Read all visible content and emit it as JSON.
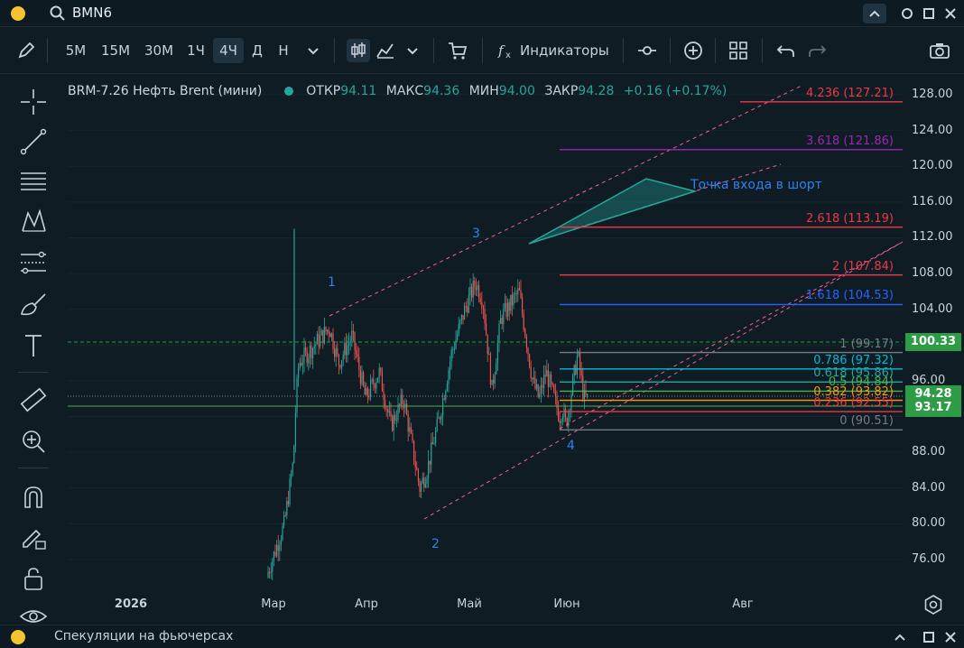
{
  "window": {
    "symbol": "BMN6"
  },
  "toolbar": {
    "timeframes": [
      "5М",
      "15М",
      "30М",
      "1Ч",
      "4Ч",
      "Д",
      "Н"
    ],
    "active_timeframe": "4Ч",
    "indicators_label": "Индикаторы"
  },
  "legend": {
    "title": "BRM-7.26 Нефть Brent (мини)",
    "open_label": "ОТКР",
    "open": "94.11",
    "high_label": "МАКС",
    "high": "94.36",
    "low_label": "МИН",
    "low": "94.00",
    "close_label": "ЗАКР",
    "close": "94.28",
    "change": "+0.16 (+0.17%)"
  },
  "y_axis": {
    "ticks": [
      "128.00",
      "124.00",
      "120.00",
      "116.00",
      "112.00",
      "108.00",
      "104.00",
      "96.00",
      "88.00",
      "84.00",
      "80.00",
      "76.00"
    ],
    "badges": [
      {
        "label": "100.33",
        "value": 100.33
      },
      {
        "label": "94.28",
        "value": 94.28
      },
      {
        "label": "93.17",
        "value": 93.17
      }
    ]
  },
  "x_axis": {
    "ticks": [
      "2026",
      "Мар",
      "Апр",
      "Май",
      "Июн",
      "Авг"
    ]
  },
  "fib_levels": [
    {
      "label": "4.236 (127.21)",
      "value": 127.21,
      "color": "#f23645"
    },
    {
      "label": "3.618 (121.86)",
      "value": 121.86,
      "color": "#9c27b0"
    },
    {
      "label": "2.618 (113.19)",
      "value": 113.19,
      "color": "#f23645"
    },
    {
      "label": "2 (107.84)",
      "value": 107.84,
      "color": "#f23645"
    },
    {
      "label": "1.618 (104.53)",
      "value": 104.53,
      "color": "#2962ff"
    },
    {
      "label": "1 (99.17)",
      "value": 99.17,
      "color": "#787b86"
    },
    {
      "label": "0.786 (97.32)",
      "value": 97.32,
      "color": "#00bcd4"
    },
    {
      "label": "0.618 (95.86)",
      "value": 95.86,
      "color": "#26a69a"
    },
    {
      "label": "0.5 (94.84)",
      "value": 94.84,
      "color": "#4caf50"
    },
    {
      "label": "0.382 (93.82)",
      "value": 93.82,
      "color": "#ff9800"
    },
    {
      "label": "0.236 (92.55)",
      "value": 92.55,
      "color": "#f23645"
    },
    {
      "label": "0 (90.51)",
      "value": 90.51,
      "color": "#787b86"
    }
  ],
  "waves": [
    "1",
    "2",
    "3",
    "4"
  ],
  "annotation": "Точка входа в шорт",
  "bottom": {
    "title": "Спекуляции на фьючерсах"
  },
  "colors": {
    "up": "#26a69a",
    "down": "#ef5350",
    "channel": "#f06292",
    "badge": "#2e9c46",
    "accent": "#2f80ed"
  }
}
